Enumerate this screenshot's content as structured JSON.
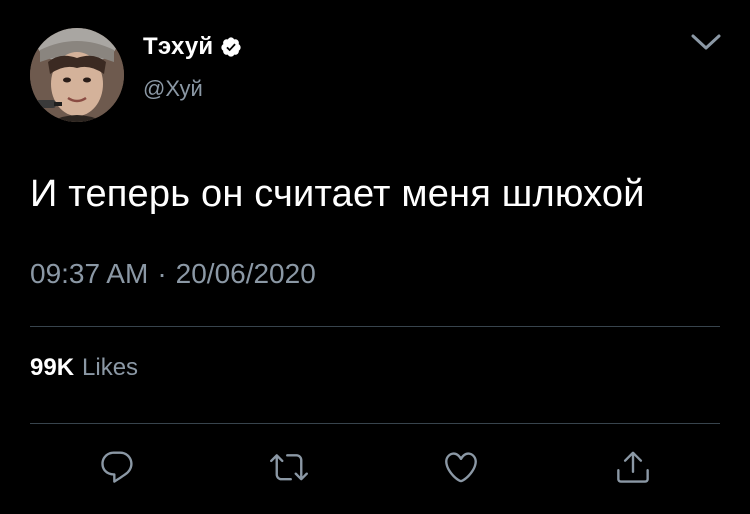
{
  "author": {
    "display_name": "Тэхуй",
    "handle": "@Хуй",
    "verified": true
  },
  "tweet": {
    "text": "И теперь он считает меня шлюхой",
    "time": "09:37 AM",
    "separator": "·",
    "date": "20/06/2020"
  },
  "stats": {
    "likes_count": "99K",
    "likes_label": "Likes"
  },
  "icons": {
    "more": "chevron-down-icon",
    "reply": "reply-icon",
    "retweet": "retweet-icon",
    "like": "heart-icon",
    "share": "share-icon",
    "verified": "verified-badge-icon"
  },
  "colors": {
    "background": "#000000",
    "text_primary": "#ffffff",
    "text_secondary": "#8b98a5",
    "divider": "#38444d"
  }
}
